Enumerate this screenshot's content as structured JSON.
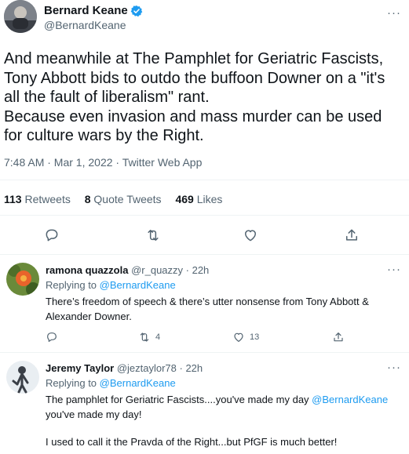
{
  "main_tweet": {
    "author_name": "Bernard Keane",
    "author_handle": "@BernardKeane",
    "text": "And meanwhile at The Pamphlet for Geriatric Fascists, Tony Abbott bids to outdo the buffoon Downer on a \"it's all the fault of liberalism\" rant.\nBecause even invasion and mass murder can be used for culture wars by the Right.",
    "meta": "7:48 AM · Mar 1, 2022 · Twitter Web App",
    "retweets_count": "113",
    "retweets_label": "Retweets",
    "quote_count": "8",
    "quote_label": "Quote Tweets",
    "likes_count": "469",
    "likes_label": "Likes",
    "more_label": "···"
  },
  "replies": [
    {
      "name": "ramona quazzola",
      "handle_time": "@r_quazzy · 22h",
      "replying_prefix": "Replying to",
      "replying_to": "@BernardKeane",
      "text": "There’s freedom of speech & there’s utter nonsense from Tony Abbott & Alexander Downer.",
      "retweets": "4",
      "likes": "13",
      "more_label": "···"
    },
    {
      "name": "Jeremy Taylor",
      "handle_time": "@jeztaylor78 · 22h",
      "replying_prefix": "Replying to",
      "replying_to": "@BernardKeane",
      "text_before": "The pamphlet for Geriatric Fascists....you've made my day ",
      "text_mention": "@BernardKeane",
      "text_after": "you've made my day!",
      "text_para2": "I used to call it the Pravda of the Right...but PfGF is much better!",
      "more_label": "···"
    }
  ],
  "colors": {
    "accent": "#1d9bf0",
    "secondary_text": "#536471",
    "divider": "#eff3f4"
  },
  "icons": [
    "verified-badge-icon",
    "reply-icon",
    "retweet-icon",
    "like-icon",
    "share-icon",
    "more-icon"
  ]
}
